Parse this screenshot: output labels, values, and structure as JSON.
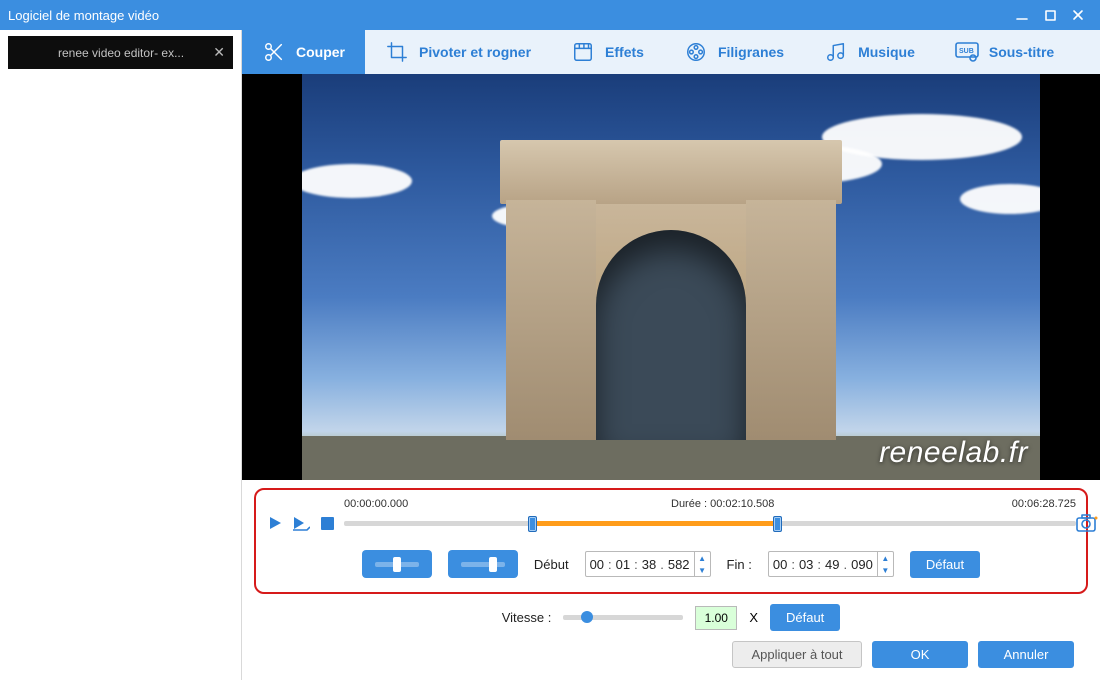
{
  "window": {
    "title": "Logiciel de montage vidéo"
  },
  "sidebar": {
    "files": [
      {
        "name": "renee video editor- ex..."
      }
    ]
  },
  "tabs": {
    "cut": {
      "label": "Couper"
    },
    "rotate": {
      "label": "Pivoter et rogner"
    },
    "effects": {
      "label": "Effets"
    },
    "watermark": {
      "label": "Filigranes"
    },
    "music": {
      "label": "Musique"
    },
    "subtitle": {
      "label": "Sous-titre"
    },
    "active": "cut"
  },
  "preview": {
    "watermark": "reneelab.fr"
  },
  "timeline": {
    "start_label": "00:00:00.000",
    "duration_label_prefix": "Durée :",
    "duration_value": "00:02:10.508",
    "end_label": "00:06:28.725",
    "sel_start_pct": 25.7,
    "sel_end_pct": 59.2
  },
  "cut": {
    "start_label": "Début",
    "start_value": {
      "h": "00",
      "m": "01",
      "s": "38",
      "ms": "582"
    },
    "end_label": "Fin :",
    "end_value": {
      "h": "00",
      "m": "03",
      "s": "49",
      "ms": "090"
    },
    "default_label": "Défaut"
  },
  "speed": {
    "label": "Vitesse :",
    "value": "1.00",
    "x": "X",
    "default_label": "Défaut",
    "pos_pct": 20
  },
  "footer": {
    "apply_all": "Appliquer à tout",
    "ok": "OK",
    "cancel": "Annuler"
  }
}
